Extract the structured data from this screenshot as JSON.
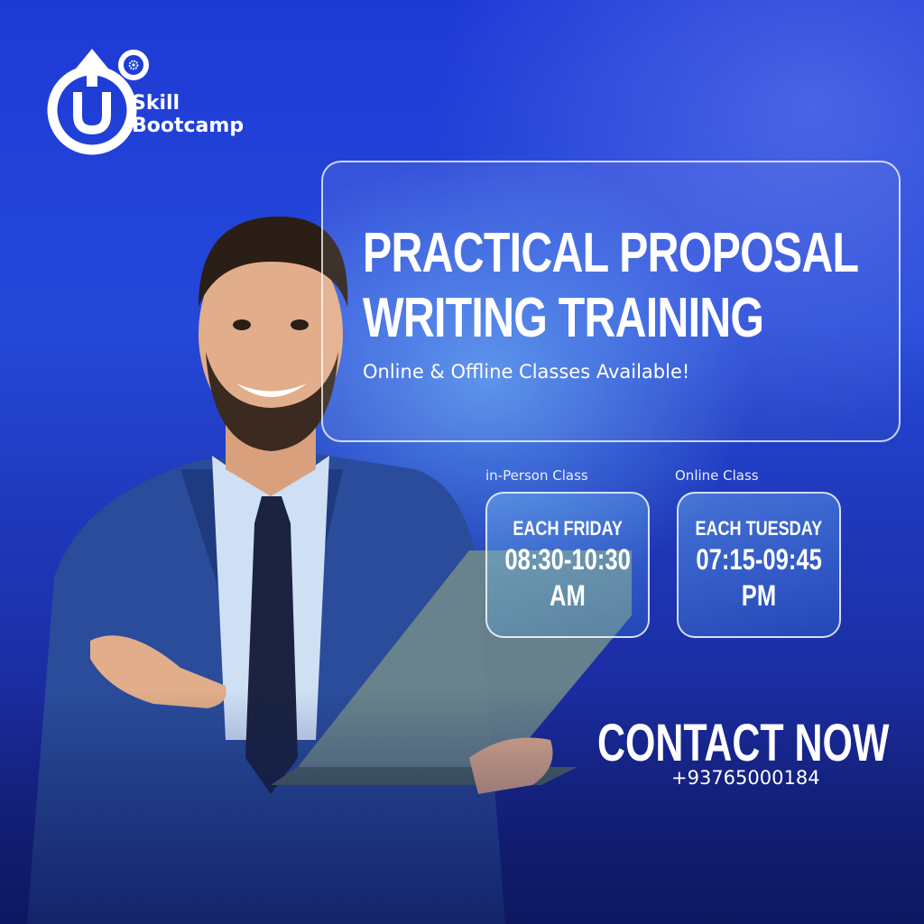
{
  "brand": {
    "name_line1": "Skill",
    "name_line2": "Bootcamp",
    "colors": {
      "primary": "#1e3ad6",
      "logo": "#ffffff"
    }
  },
  "headline": {
    "line1": "PRACTICAL PROPOSAL",
    "line2": "WRITING TRAINING",
    "subtitle": "Online & Offline Classes Available!"
  },
  "classes": [
    {
      "label": "in-Person Class",
      "day": "EACH FRIDAY",
      "time_line1": "08:30-10:30",
      "time_line2": "AM"
    },
    {
      "label": "Online Class",
      "day": "EACH TUESDAY",
      "time_line1": "07:15-09:45",
      "time_line2": "PM"
    }
  ],
  "contact": {
    "cta": "CONTACT NOW",
    "phone": "+93765000184"
  },
  "icons": [
    "logo-mark-icon",
    "gear-icon"
  ]
}
